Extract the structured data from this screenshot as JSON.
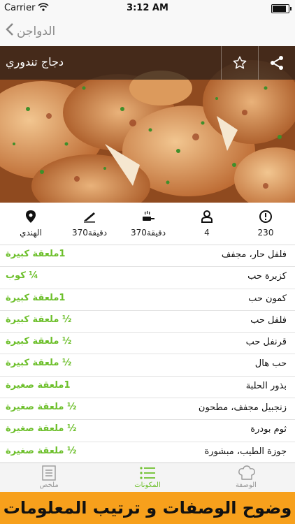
{
  "status_bar": {
    "carrier": "Carrier",
    "time": "3:12 AM",
    "battery_level": 0.85
  },
  "nav": {
    "back_label": "الدواجن"
  },
  "recipe": {
    "title": "دجاج تندوري"
  },
  "info": {
    "calories": "230",
    "servings": "4",
    "cook_time": "370دقيقة",
    "prep_time": "370دقيقة",
    "cuisine": "الهندي"
  },
  "ingredients": [
    {
      "name": "فلفل حار، مجفف",
      "amount": "1ملعقة كبيرة"
    },
    {
      "name": "كزبرة حب",
      "amount": "¼ كوب"
    },
    {
      "name": "كمون حب",
      "amount": "1ملعقة كبيرة"
    },
    {
      "name": "فلفل حب",
      "amount": "½ ملعقة كبيرة"
    },
    {
      "name": "قرنفل حب",
      "amount": "½ ملعقة كبيرة"
    },
    {
      "name": "حب هال",
      "amount": "½ ملعقة كبيرة"
    },
    {
      "name": "بذور الحلبة",
      "amount": "1ملعقة صغيرة"
    },
    {
      "name": "زنجبيل مجفف، مطحون",
      "amount": "½ ملعقة صغيرة"
    },
    {
      "name": "ثوم بودرة",
      "amount": "½ ملعقة صغيرة"
    },
    {
      "name": "جوزة الطيب، مبشورة",
      "amount": "½ ملعقة صغيرة"
    }
  ],
  "tabs": {
    "summary": "ملخص",
    "ingredients": "المكونات",
    "recipe": "الوصفة"
  },
  "banner": {
    "text": "وضوح الوصفات و ترتيب المعلومات"
  },
  "colors": {
    "accent_green": "#6cbf2a",
    "banner_orange": "#f7a01c",
    "icon_dark": "#111111"
  }
}
